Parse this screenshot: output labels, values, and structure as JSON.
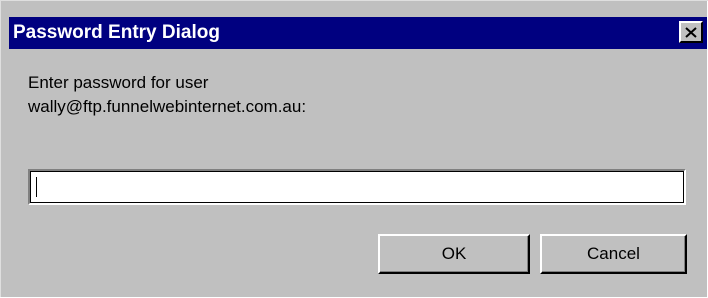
{
  "window": {
    "title": "Password Entry Dialog",
    "close_icon": "close-icon"
  },
  "prompt": {
    "line1": "Enter password for user",
    "line2": "wally@ftp.funnelwebinternet.com.au:"
  },
  "password_field": {
    "value": "",
    "placeholder": ""
  },
  "buttons": {
    "ok_label": "OK",
    "cancel_label": "Cancel"
  },
  "colors": {
    "titlebar": "#000080",
    "face": "#c0c0c0"
  }
}
